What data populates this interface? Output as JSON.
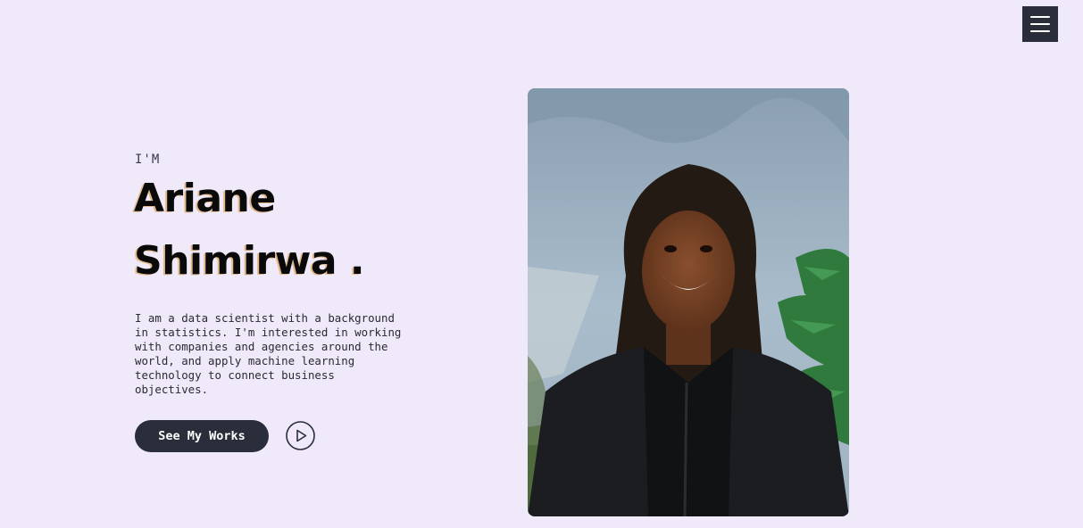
{
  "nav": {
    "menu_icon": "hamburger-menu-icon"
  },
  "hero": {
    "intro": "I'M",
    "first_name": "Ariane",
    "last_name": "Shimirwa",
    "dot": ".",
    "description": "I am a data scientist with a background\nin statistics. I'm interested in working\nwith companies and agencies around the\nworld, and apply machine learning\ntechnology to connect business\nobjectives.",
    "cta_label": "See My Works",
    "play_icon": "play-circle-icon"
  },
  "photo": {
    "subject": "portrait-photo"
  },
  "colors": {
    "background": "#efe9f9",
    "dark": "#2a2e3b",
    "name_shadow": "#e4b98a"
  }
}
